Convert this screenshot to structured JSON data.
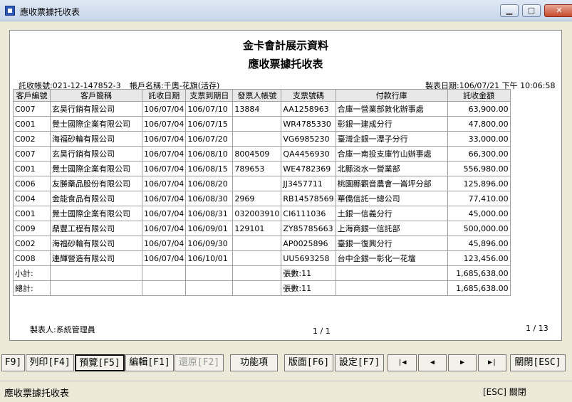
{
  "window": {
    "title": "應收票據托收表",
    "min": "▁",
    "max": "□",
    "close": "✕"
  },
  "report": {
    "company": "金卡會計展示資料",
    "title": "應收票據托收表",
    "account": "託收帳號:021-12-147852-3",
    "account_name": "帳戶名稱:千奧-花旗(活存)",
    "print_date": "製表日期:106/07/21 下午 10:06:58",
    "columns": [
      "客戶編號",
      "客戶簡稱",
      "託收日期",
      "支票到期日",
      "發票人帳號",
      "支票號碼",
      "付款行庫",
      "託收金額"
    ],
    "rows": [
      [
        "C007",
        "玄昊行銷有限公司",
        "106/07/04",
        "106/07/10",
        "13884",
        "AA1258963",
        "合庫一營業部敦化辦事處",
        "63,900.00"
      ],
      [
        "C001",
        "覺士國際企業有限公司",
        "106/07/04",
        "106/07/15",
        "",
        "WR4785330",
        "彰銀一建成分行",
        "47,800.00"
      ],
      [
        "C002",
        "海福砂輪有限公司",
        "106/07/04",
        "106/07/20",
        "",
        "VG6985230",
        "臺灣企銀一潭子分行",
        "33,000.00"
      ],
      [
        "C007",
        "玄昊行銷有限公司",
        "106/07/04",
        "106/08/10",
        "8004509",
        "QA4456930",
        "合庫一南投支庫竹山辦事處",
        "66,300.00"
      ],
      [
        "C001",
        "覺士國際企業有限公司",
        "106/07/04",
        "106/08/15",
        "789653",
        "WE4782369",
        "北縣淡水一營業部",
        "556,980.00"
      ],
      [
        "C006",
        "友勝藥品股份有限公司",
        "106/07/04",
        "106/08/20",
        "",
        "JJ3457711",
        "桃園縣觀音農會一崙坪分部",
        "125,896.00"
      ],
      [
        "C004",
        "金能食品有限公司",
        "106/07/04",
        "106/08/30",
        "2969",
        "RB14578569",
        "華僑信託一總公司",
        "77,410.00"
      ],
      [
        "C001",
        "覺士國際企業有限公司",
        "106/07/04",
        "106/08/31",
        "032003910",
        "CI6111036",
        "土銀一信義分行",
        "45,000.00"
      ],
      [
        "C009",
        "鼎豐工程有限公司",
        "106/07/04",
        "106/09/01",
        "129101",
        "ZY85785663",
        "上海商銀一信託部",
        "500,000.00"
      ],
      [
        "C002",
        "海福砂輪有限公司",
        "106/07/04",
        "106/09/30",
        "",
        "AP0025896",
        "臺銀一復興分行",
        "45,896.00"
      ],
      [
        "C008",
        "連輝營造有限公司",
        "106/07/04",
        "106/10/01",
        "",
        "UU5693258",
        "台中企銀一彰化一花壇",
        "123,456.00"
      ],
      [
        "小計:",
        "",
        "",
        "",
        "",
        "張數:11",
        "",
        "1,685,638.00"
      ],
      [
        "總計:",
        "",
        "",
        "",
        "",
        "張數:11",
        "",
        "1,685,638.00"
      ]
    ],
    "maker": "製表人:系統管理員",
    "page": "1 / 1",
    "page_total": "1 / 13"
  },
  "toolbar": {
    "f9": "F9]",
    "print": "列印[F4]",
    "preview": "預覽[F5]",
    "edit": "編輯[F1]",
    "restore": "還原[F2]",
    "func": "功能項",
    "layout": "版面[F6]",
    "setting": "設定[F7]",
    "first": "|◀",
    "prev": "◀",
    "next": "▶",
    "last": "▶|",
    "close": "關閉[ESC]"
  },
  "status": {
    "left": "應收票據托收表",
    "right": "[ESC] 關閉"
  }
}
